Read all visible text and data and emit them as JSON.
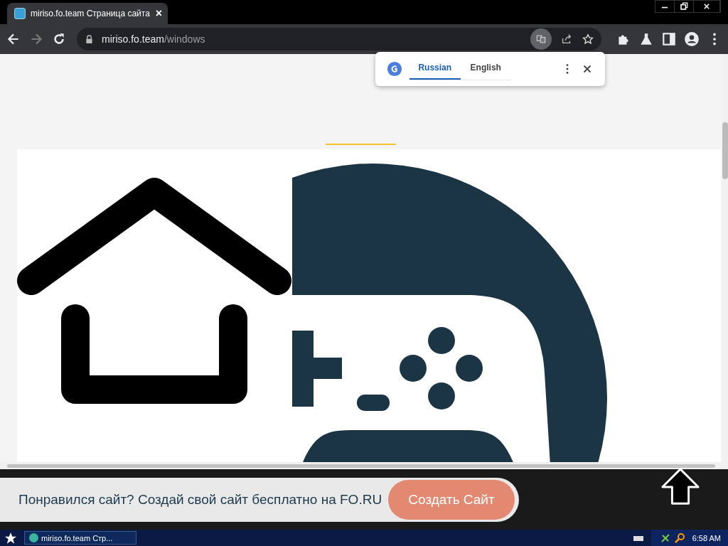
{
  "browser": {
    "tab": {
      "title": "miriso.fo.team Страница сайта",
      "close": "×"
    },
    "address": {
      "host": "miriso.fo.team",
      "path": "/windows"
    }
  },
  "translate_popup": {
    "languages": [
      {
        "label": "Russian",
        "selected": true
      },
      {
        "label": "English",
        "selected": false
      }
    ]
  },
  "banner": {
    "text": "Понравился сайт? Создай свой сайт бесплатно на FO.RU",
    "button": "Создать Сайт"
  },
  "taskbar": {
    "window": "miriso.fo.team Стр...",
    "clock": "6:58 AM"
  }
}
